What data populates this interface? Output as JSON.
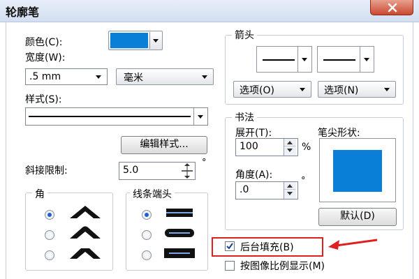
{
  "window": {
    "title": "轮廓笔"
  },
  "colors": {
    "swatch": "#0a7fd8",
    "preview": "#0a7fd8",
    "callout": "#e02020"
  },
  "left": {
    "color_label": "颜色(C):",
    "width_label": "宽度(W):",
    "width_value": ".5 mm",
    "unit_value": "毫米",
    "style_label": "样式(S):",
    "edit_style_button": "编辑样式...",
    "miter_label": "斜接限制:",
    "miter_value": "5.0",
    "degree_symbol": "°"
  },
  "corners": {
    "title": "角",
    "options": [
      {
        "name": "miter",
        "checked": true
      },
      {
        "name": "round",
        "checked": false
      },
      {
        "name": "bevel",
        "checked": false
      }
    ]
  },
  "line_caps": {
    "title": "线条端头",
    "options": [
      {
        "name": "butt",
        "checked": true
      },
      {
        "name": "round",
        "checked": false
      },
      {
        "name": "square",
        "checked": false
      }
    ]
  },
  "arrows": {
    "title": "箭头",
    "options_left": "选项(O)",
    "options_right": "选项(N)"
  },
  "calligraphy": {
    "title": "书法",
    "stretch_label": "展开(T):",
    "stretch_value": "100",
    "percent": "%",
    "angle_label": "角度(A):",
    "angle_value": ".0",
    "degree_symbol": "°",
    "nib_label": "笔尖形状:",
    "default_button": "默认(D)"
  },
  "options": {
    "behind_fill_label": "后台填充(B)",
    "behind_fill_checked": true,
    "scale_label": "按图像比例显示(M)",
    "scale_checked": false
  }
}
